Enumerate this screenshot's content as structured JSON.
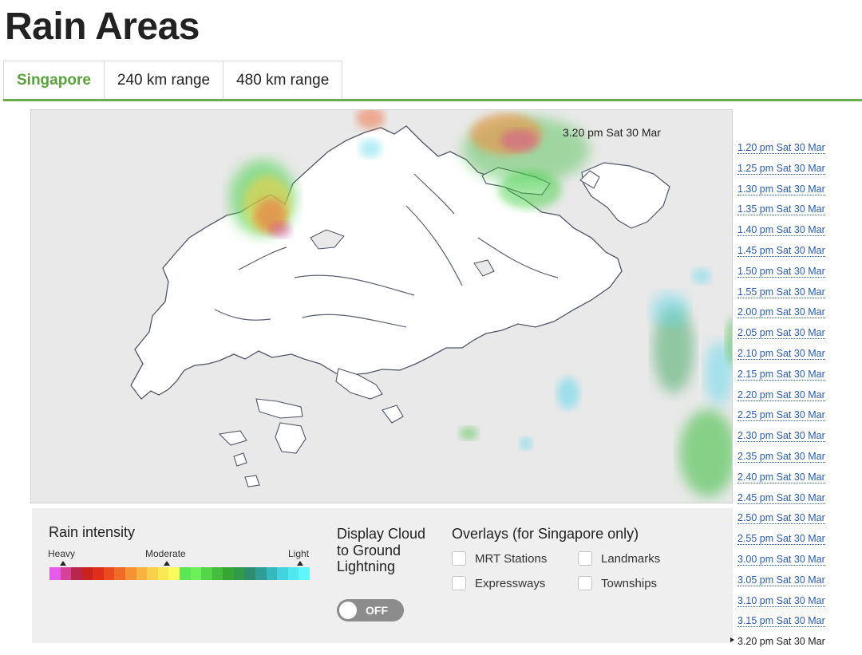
{
  "page": {
    "title": "Rain Areas"
  },
  "tabs": [
    {
      "label": "Singapore",
      "active": true
    },
    {
      "label": "240 km range",
      "active": false
    },
    {
      "label": "480 km range",
      "active": false
    }
  ],
  "map": {
    "timestamp": "3.20 pm Sat 30 Mar"
  },
  "legend": {
    "title": "Rain intensity",
    "labels": {
      "heavy": "Heavy",
      "moderate": "Moderate",
      "light": "Light"
    },
    "colors": [
      "#e65be9",
      "#d8419a",
      "#b8264c",
      "#c9231f",
      "#df2e1a",
      "#ea4b1d",
      "#ef6c26",
      "#f59233",
      "#f7b340",
      "#f9cf4b",
      "#fbe855",
      "#f9fb5c",
      "#5be654",
      "#6ef05a",
      "#56d54b",
      "#44bc3d",
      "#35a632",
      "#2f9a4a",
      "#2d8e6e",
      "#2f9c96",
      "#37b8bf",
      "#43d3dd",
      "#50e8f0",
      "#5ef7fb"
    ]
  },
  "lightning": {
    "title": "Display Cloud to Ground Lightning",
    "toggle_label": "OFF",
    "enabled": false
  },
  "overlays": {
    "title": "Overlays (for Singapore only)",
    "items": [
      {
        "label": "MRT Stations",
        "checked": false
      },
      {
        "label": "Landmarks",
        "checked": false
      },
      {
        "label": "Expressways",
        "checked": false
      },
      {
        "label": "Townships",
        "checked": false
      }
    ]
  },
  "time_list": [
    "1.20 pm Sat 30 Mar",
    "1.25 pm Sat 30 Mar",
    "1.30 pm Sat 30 Mar",
    "1.35 pm Sat 30 Mar",
    "1.40 pm Sat 30 Mar",
    "1.45 pm Sat 30 Mar",
    "1.50 pm Sat 30 Mar",
    "1.55 pm Sat 30 Mar",
    "2.00 pm Sat 30 Mar",
    "2.05 pm Sat 30 Mar",
    "2.10 pm Sat 30 Mar",
    "2.15 pm Sat 30 Mar",
    "2.20 pm Sat 30 Mar",
    "2.25 pm Sat 30 Mar",
    "2.30 pm Sat 30 Mar",
    "2.35 pm Sat 30 Mar",
    "2.40 pm Sat 30 Mar",
    "2.45 pm Sat 30 Mar",
    "2.50 pm Sat 30 Mar",
    "2.55 pm Sat 30 Mar",
    "3.00 pm Sat 30 Mar",
    "3.05 pm Sat 30 Mar",
    "3.10 pm Sat 30 Mar",
    "3.15 pm Sat 30 Mar",
    "3.20 pm Sat 30 Mar"
  ],
  "current_time_index": 24
}
